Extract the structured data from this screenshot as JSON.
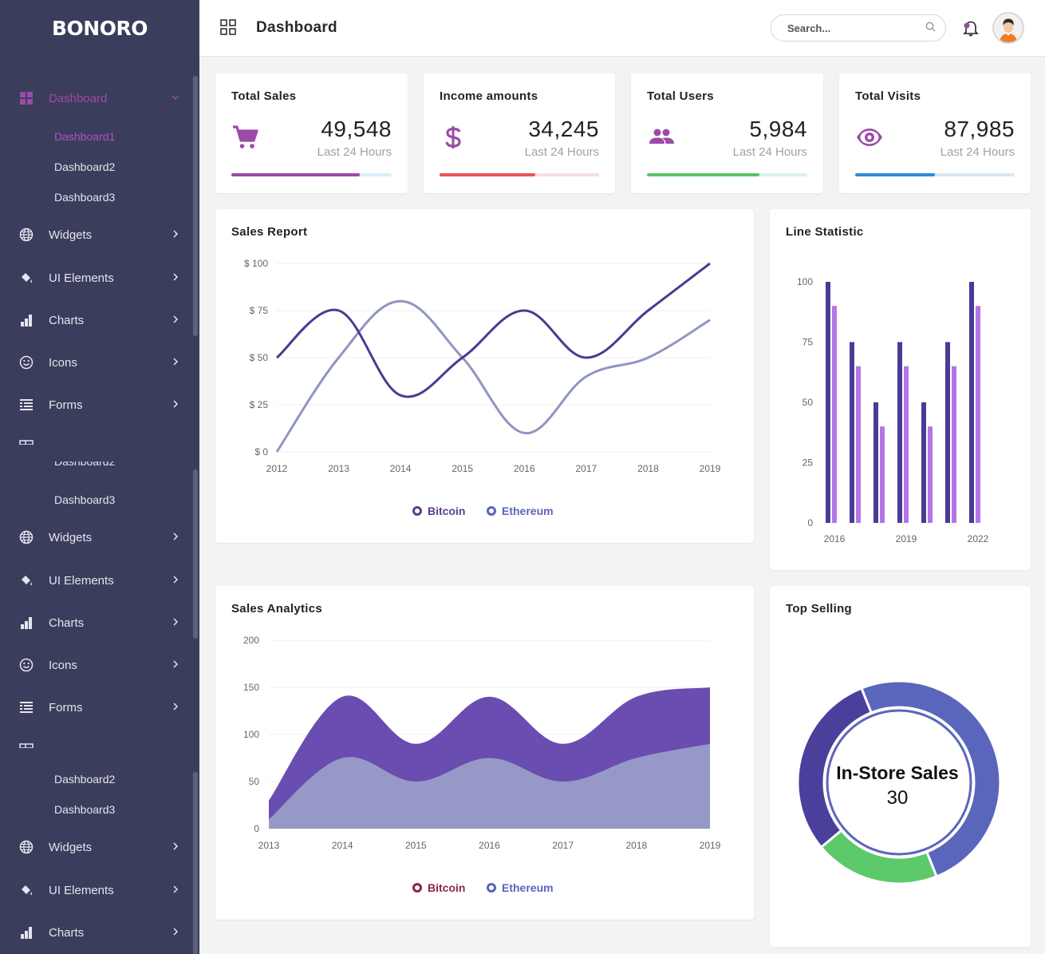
{
  "brand": "BONORO",
  "sidebar": {
    "sections": [
      {
        "dashboard": "Dashboard",
        "subs": [
          "Dashboard1",
          "Dashboard2",
          "Dashboard3"
        ]
      }
    ],
    "items": {
      "dashboard": "Dashboard",
      "dashboard1": "Dashboard1",
      "dashboard2": "Dashboard2",
      "dashboard3": "Dashboard3",
      "widgets": "Widgets",
      "ui_elements": "UI Elements",
      "charts": "Charts",
      "icons": "Icons",
      "forms": "Forms"
    }
  },
  "header": {
    "title": "Dashboard",
    "search_placeholder": "Search..."
  },
  "stats": [
    {
      "title": "Total Sales",
      "value": "49,548",
      "sub": "Last 24 Hours",
      "icon": "cart-icon",
      "color": "#9b4aa8",
      "track": "#d7f0f8",
      "progress": 0.8
    },
    {
      "title": "Income amounts",
      "value": "34,245",
      "sub": "Last 24 Hours",
      "icon": "dollar-icon",
      "color": "#e9545a",
      "track": "#f7dedf",
      "progress": 0.6
    },
    {
      "title": "Total Users",
      "value": "5,984",
      "sub": "Last 24 Hours",
      "icon": "users-icon",
      "color": "#5cc36b",
      "track": "#d8f3e2",
      "progress": 0.7
    },
    {
      "title": "Total Visits",
      "value": "87,985",
      "sub": "Last 24 Hours",
      "icon": "eye-icon",
      "color": "#2a8bd9",
      "track": "#dce7f3",
      "progress": 0.5
    }
  ],
  "panels": {
    "sales_report": "Sales Report",
    "line_statistic": "Line Statistic",
    "sales_analytics": "Sales Analytics",
    "top_selling": "Top Selling"
  },
  "chart_data": [
    {
      "type": "line",
      "title": "Sales Report",
      "x": [
        2012,
        2013,
        2014,
        2015,
        2016,
        2017,
        2018,
        2019
      ],
      "yticks": [
        "$ 0",
        "$ 25",
        "$ 50",
        "$ 75",
        "$ 100"
      ],
      "ylim": [
        0,
        100
      ],
      "series": [
        {
          "name": "Bitcoin",
          "color": "#4b3a93",
          "values": [
            50,
            75,
            30,
            50,
            75,
            50,
            75,
            100
          ]
        },
        {
          "name": "Ethereum",
          "color": "#8f95c2",
          "values": [
            0,
            50,
            80,
            50,
            10,
            40,
            50,
            70
          ]
        }
      ],
      "legend": "bottom"
    },
    {
      "type": "bar",
      "title": "Line Statistic",
      "x": [
        2016,
        2017,
        2018,
        2019,
        2020,
        2021,
        2022
      ],
      "xticks": [
        "2016",
        "2019",
        "2022"
      ],
      "yticks": [
        "0",
        "25",
        "50",
        "75",
        "100"
      ],
      "ylim": [
        0,
        100
      ],
      "series": [
        {
          "color": "#4b3a93",
          "values": [
            100,
            75,
            50,
            75,
            50,
            75,
            100
          ]
        },
        {
          "color": "#b575e6",
          "values": [
            90,
            65,
            40,
            65,
            40,
            65,
            90
          ]
        }
      ]
    },
    {
      "type": "area",
      "title": "Sales Analytics",
      "x": [
        2013,
        2014,
        2015,
        2016,
        2017,
        2018,
        2019
      ],
      "yticks": [
        "0",
        "50",
        "100",
        "150",
        "200"
      ],
      "ylim": [
        0,
        200
      ],
      "series": [
        {
          "name": "Bitcoin",
          "color": "#6a4db0",
          "legend_color": "#8c2640",
          "values": [
            30,
            140,
            90,
            140,
            90,
            140,
            150
          ]
        },
        {
          "name": "Ethereum",
          "color": "#9699c8",
          "legend_color": "#5b63be",
          "values": [
            10,
            75,
            50,
            75,
            50,
            75,
            90
          ]
        }
      ],
      "legend": "bottom"
    },
    {
      "type": "pie",
      "title": "Top Selling",
      "center_label": "In-Store Sales",
      "center_value": "30",
      "slices": [
        {
          "value": 50,
          "color": "#5a66bb"
        },
        {
          "value": 20,
          "color": "#5cc96a"
        },
        {
          "value": 30,
          "color": "#4b3f9c"
        }
      ]
    }
  ]
}
